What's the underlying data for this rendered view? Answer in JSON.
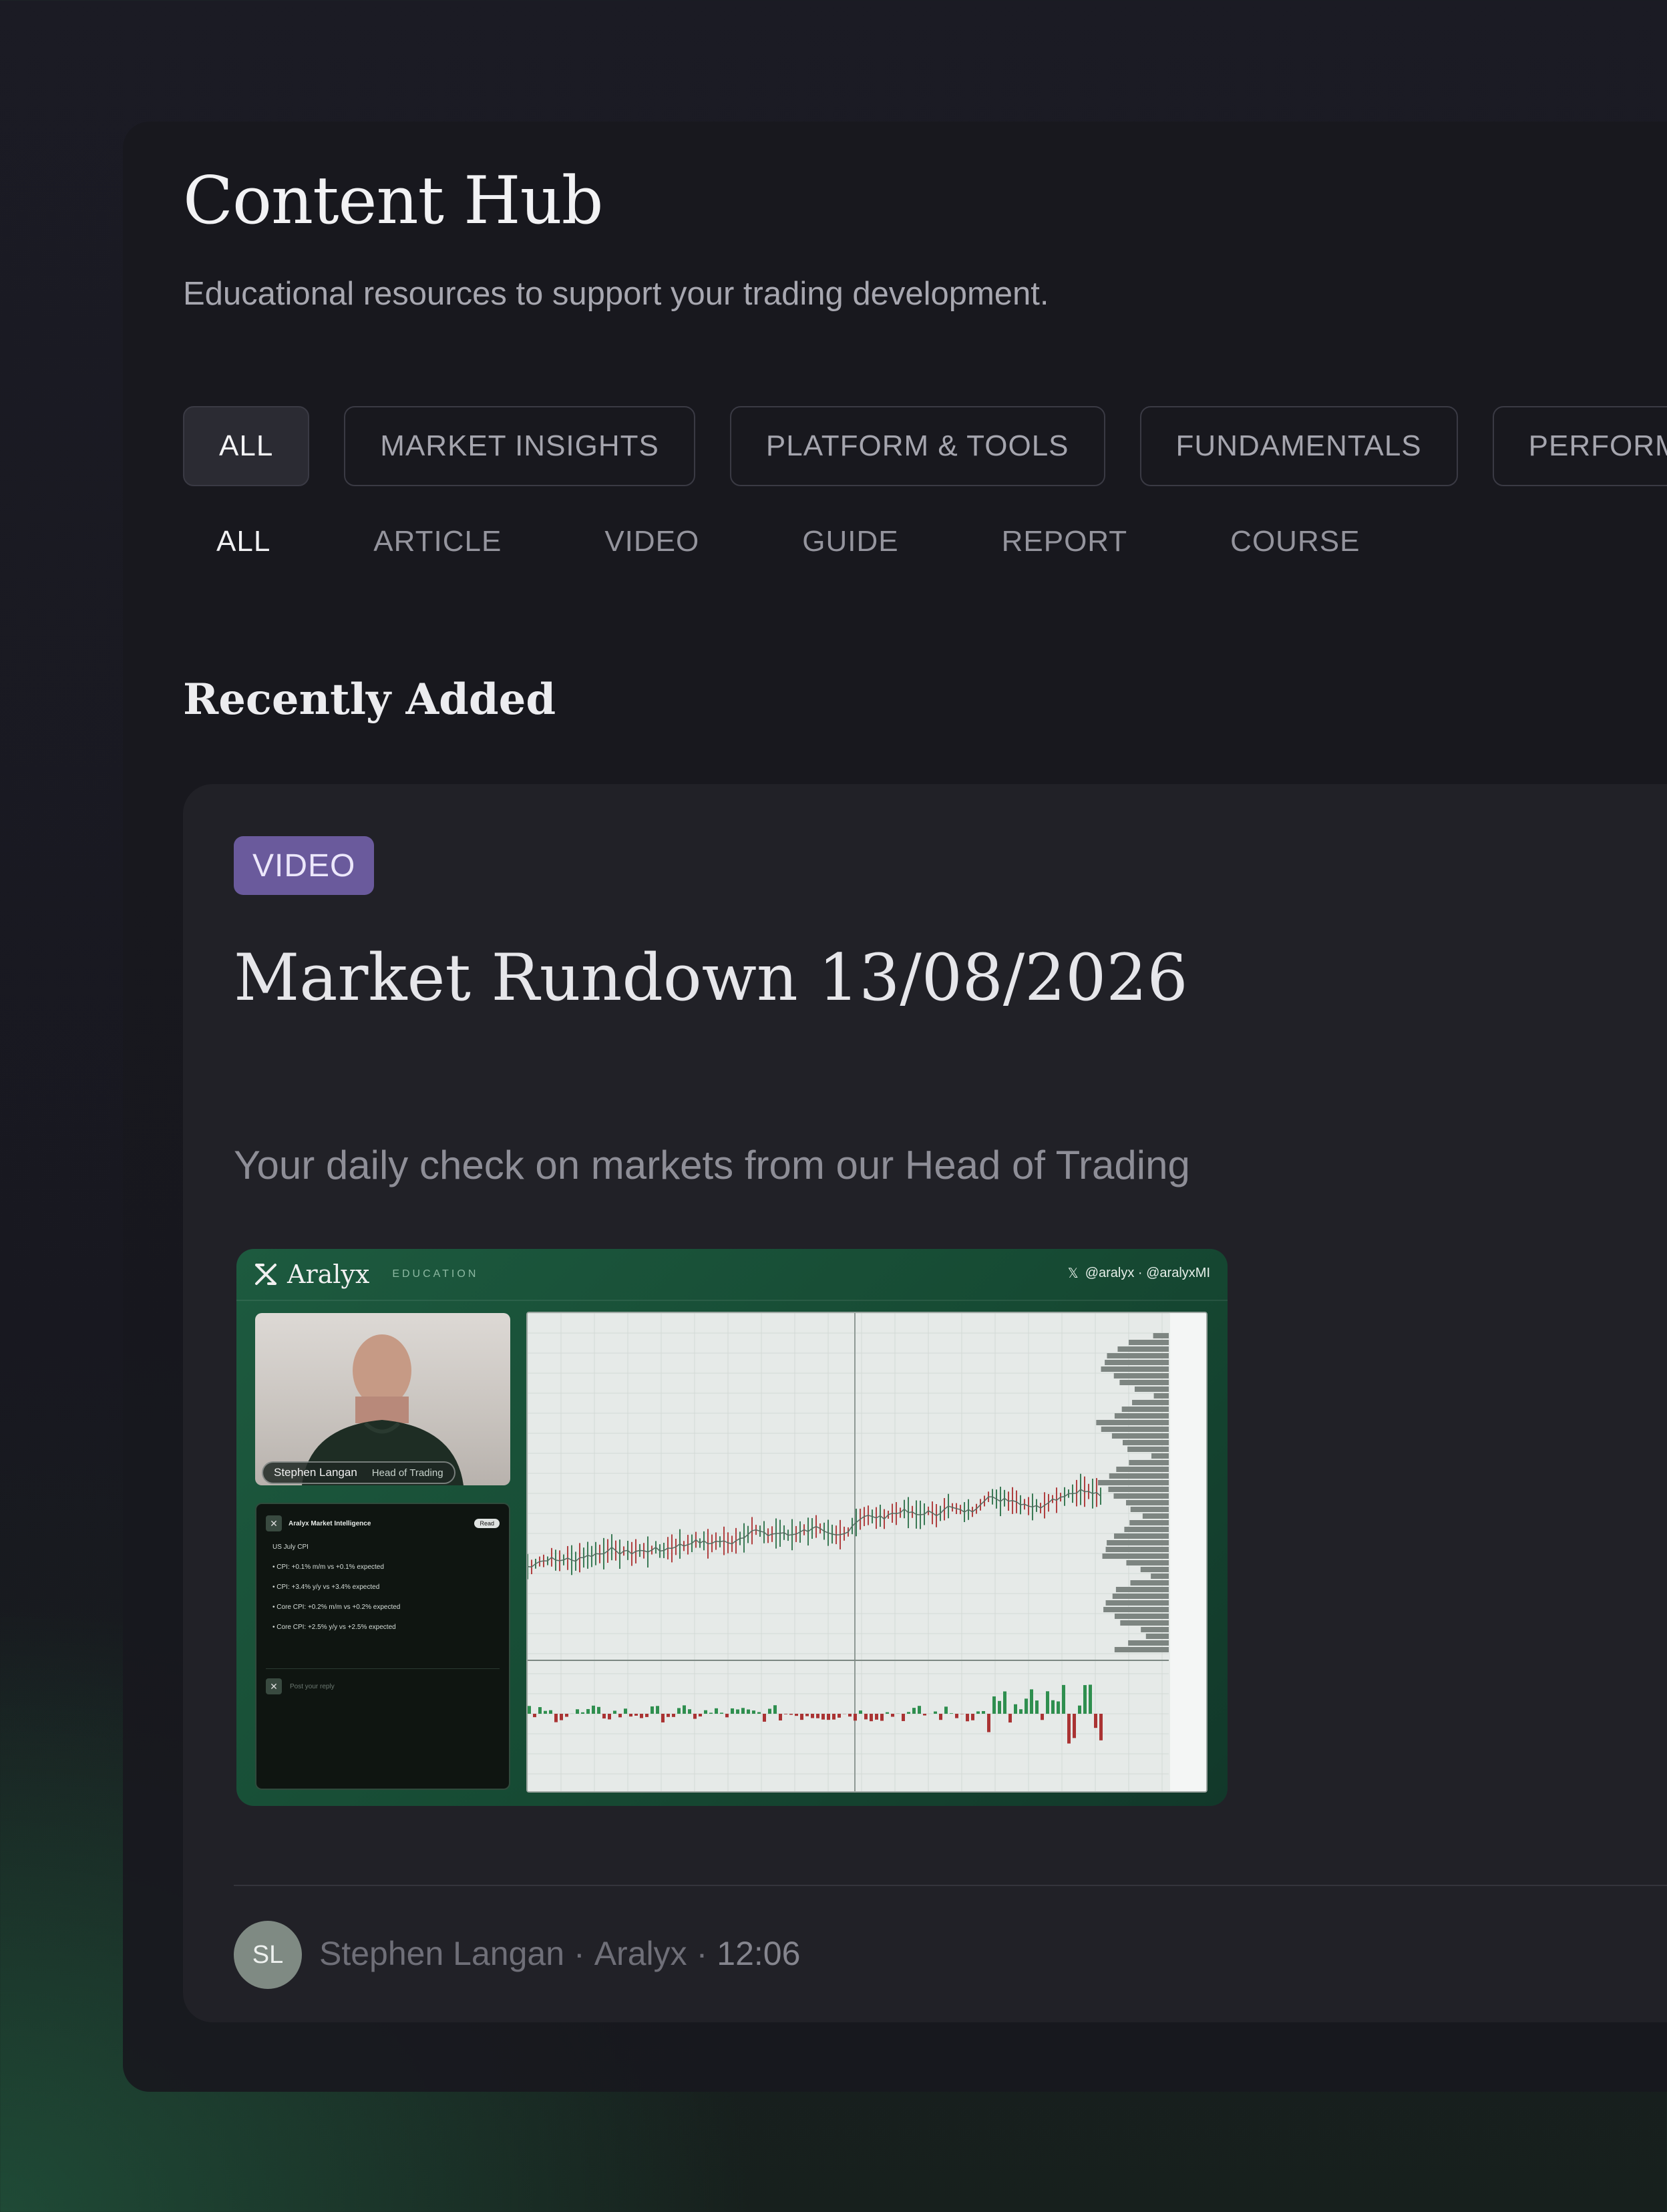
{
  "page": {
    "title": "Content Hub",
    "subtitle": "Educational resources to support your trading development."
  },
  "categories": {
    "items": [
      {
        "label": "ALL",
        "active": true
      },
      {
        "label": "MARKET INSIGHTS",
        "active": false
      },
      {
        "label": "PLATFORM & TOOLS",
        "active": false
      },
      {
        "label": "FUNDAMENTALS",
        "active": false
      },
      {
        "label": "PERFORMA",
        "active": false
      }
    ]
  },
  "content_types": {
    "items": [
      {
        "label": "ALL",
        "active": true
      },
      {
        "label": "ARTICLE",
        "active": false
      },
      {
        "label": "VIDEO",
        "active": false
      },
      {
        "label": "GUIDE",
        "active": false
      },
      {
        "label": "REPORT",
        "active": false
      },
      {
        "label": "COURSE",
        "active": false
      }
    ]
  },
  "section": {
    "title": "Recently Added"
  },
  "card": {
    "badge": "VIDEO",
    "title": "Market Rundown 13/08/2026",
    "description": "Your daily check on markets from our Head of Trading",
    "author_initials": "SL",
    "author": "Stephen Langan",
    "source": "Aralyx",
    "separator": "·",
    "time": "12:06"
  },
  "thumbnail": {
    "brand": "Aralyx",
    "brand_tag": "EDUCATION",
    "social": "@aralyx · @aralyxMI",
    "presenter_name": "Stephen Langan",
    "presenter_role": "Head of Trading",
    "tweet_author": "Aralyx Market Intelligence",
    "tweet_follow": "Read",
    "tweet_heading": "US July CPI",
    "tweet_lines": [
      "• CPI: +0.1% m/m vs +0.1% expected",
      "• CPI: +3.4% y/y vs +3.4% expected",
      "• Core CPI: +0.2% m/m vs +0.2% expected",
      "• Core CPI: +2.5% y/y vs +2.5% expected"
    ],
    "reply_placeholder": "Post your reply"
  },
  "colors": {
    "badge_bg": "#6a5a9c",
    "accent_green": "#1d5a3f",
    "active_chip_bg": "#2b2b33"
  }
}
